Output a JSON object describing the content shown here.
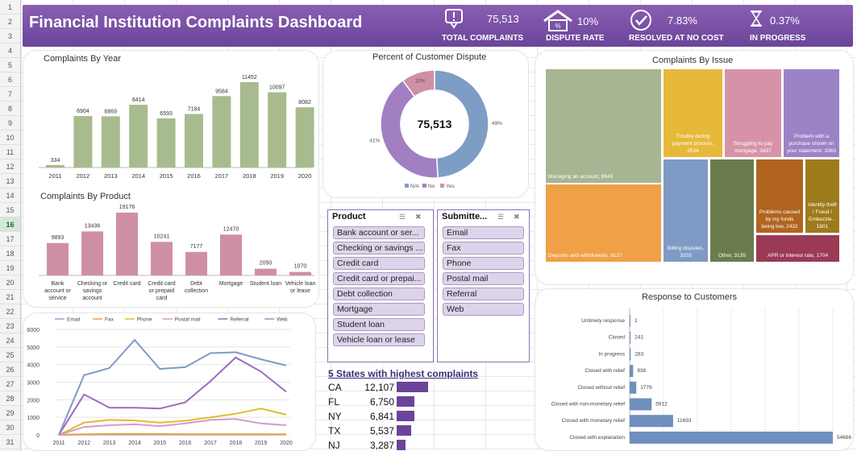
{
  "row_numbers": [
    "1",
    "2",
    "3",
    "4",
    "5",
    "6",
    "7",
    "8",
    "9",
    "10",
    "11",
    "12",
    "13",
    "14",
    "15",
    "16",
    "17",
    "18",
    "19",
    "20",
    "21",
    "22",
    "23",
    "24",
    "25",
    "26",
    "27",
    "28",
    "29",
    "30",
    "31"
  ],
  "selected_row": "16",
  "header": {
    "title": "Financial Institution Complaints Dashboard",
    "kpis": [
      {
        "value": "75,513",
        "label": "TOTAL COMPLAINTS",
        "icon": "complaint-icon"
      },
      {
        "value": "10%",
        "label": "DISPUTE RATE",
        "icon": "house-icon"
      },
      {
        "value": "7.83%",
        "label": "RESOLVED AT NO COST",
        "icon": "check-circle-icon"
      },
      {
        "value": "0.37%",
        "label": "IN PROGRESS",
        "icon": "hourglass-icon"
      }
    ]
  },
  "colors": {
    "banner": "#6b449a",
    "green": "#a8bb8e",
    "pink": "#cf8fa4",
    "blue": "#7e9dc4",
    "purple": "#a27fc3",
    "steel": "#6f8fbf"
  },
  "charts": {
    "by_year": {
      "title": "Complaints By Year",
      "chart_data": {
        "type": "bar",
        "categories": [
          "2011",
          "2012",
          "2013",
          "2014",
          "2015",
          "2016",
          "2017",
          "2018",
          "2019",
          "2020"
        ],
        "values": [
          334,
          6904,
          6869,
          8414,
          6593,
          7184,
          9584,
          11452,
          10097,
          8082
        ]
      }
    },
    "by_product": {
      "title": "Complaints By Product",
      "chart_data": {
        "type": "bar",
        "categories": [
          [
            "Bank",
            "account or",
            "service"
          ],
          [
            "Checking or",
            "savings",
            "account"
          ],
          [
            "Credit card"
          ],
          [
            "Credit card",
            "or prepaid",
            "card"
          ],
          [
            "Debt",
            "collection"
          ],
          [
            "Mortgage"
          ],
          [
            "Student loan"
          ],
          [
            "Vehicle loan",
            "or lease"
          ]
        ],
        "values": [
          9893,
          13436,
          19176,
          10241,
          7177,
          12470,
          2050,
          1070
        ]
      }
    },
    "dispute": {
      "title": "Percent of Customer Dispute",
      "center": "75,513",
      "chart_data": {
        "type": "pie",
        "categories": [
          "N/A",
          "No",
          "Yes"
        ],
        "values": [
          49,
          41,
          10
        ],
        "labels": [
          "49%",
          "41%",
          "10%"
        ],
        "legend": [
          "N/A",
          "No",
          "Yes"
        ]
      }
    },
    "by_issue": {
      "title": "Complaints By Issue",
      "chart_data": {
        "type": "treemap",
        "items": [
          {
            "label": "Managing an account, 8849",
            "value": 8849
          },
          {
            "label": "Deposits and withdrawals, 6127",
            "value": 6127
          },
          {
            "label": "Trouble during payment process, 3534",
            "value": 3534
          },
          {
            "label": "Struggling to pay mortgage, 3437",
            "value": 3437
          },
          {
            "label": "Problem with a purchase shown on your statement, 3365",
            "value": 3365
          },
          {
            "label": "Billing disputes, 3203",
            "value": 3203
          },
          {
            "label": "Other, 3135",
            "value": 3135
          },
          {
            "label": "Problems caused by my funds being low, 2432",
            "value": 2432
          },
          {
            "label": "Identity theft / Fraud / Embezzle... 1801",
            "value": 1801
          },
          {
            "label": "APR or interest rate, 1704",
            "value": 1704
          }
        ]
      }
    },
    "by_channel": {
      "chart_data": {
        "type": "line",
        "x": [
          "2011",
          "2012",
          "2013",
          "2014",
          "2015",
          "2016",
          "2017",
          "2018",
          "2019",
          "2020"
        ],
        "ylim": [
          0,
          6000
        ],
        "yticks": [
          "0",
          "1000",
          "2000",
          "3000",
          "4000",
          "5000",
          "6000"
        ],
        "series": [
          {
            "name": "Email",
            "values": [
              0,
              20,
              20,
              20,
              20,
              20,
              20,
              20,
              20,
              20
            ]
          },
          {
            "name": "Fax",
            "values": [
              0,
              30,
              60,
              60,
              50,
              40,
              40,
              40,
              40,
              30
            ]
          },
          {
            "name": "Phone",
            "values": [
              0,
              700,
              850,
              820,
              700,
              800,
              1000,
              1200,
              1500,
              1150
            ]
          },
          {
            "name": "Postal mail",
            "values": [
              0,
              450,
              550,
              600,
              500,
              650,
              850,
              900,
              650,
              550
            ]
          },
          {
            "name": "Referral",
            "values": [
              0,
              2300,
              1550,
              1550,
              1500,
              1850,
              3050,
              4400,
              3600,
              2450
            ]
          },
          {
            "name": "Web",
            "values": [
              0,
              3400,
              3800,
              5400,
              3750,
              3850,
              4650,
              4700,
              4300,
              3950
            ]
          }
        ]
      }
    },
    "response": {
      "title": "Response to Customers",
      "chart_data": {
        "type": "bar",
        "orientation": "horizontal",
        "categories": [
          "Untimely response",
          "Closed",
          "In progress",
          "Closed with relief",
          "Closed without relief",
          "Closed with non-monetary relief",
          "Closed with monetary relief",
          "Closed with explanation"
        ],
        "values": [
          1,
          241,
          283,
          938,
          1779,
          5912,
          11693,
          54666
        ]
      }
    }
  },
  "slicers": {
    "product": {
      "title": "Product",
      "items": [
        "Bank account or ser...",
        "Checking or savings ...",
        "Credit card",
        "Credit card or prepai...",
        "Debt collection",
        "Mortgage",
        "Student loan",
        "Vehicle loan or lease"
      ]
    },
    "submitted": {
      "title": "Submitte...",
      "items": [
        "Email",
        "Fax",
        "Phone",
        "Postal mail",
        "Referral",
        "Web"
      ]
    }
  },
  "states": {
    "title": "5 States with highest complaints",
    "rows": [
      {
        "state": "CA",
        "value": "12,107",
        "n": 12107
      },
      {
        "state": "FL",
        "value": "6,750",
        "n": 6750
      },
      {
        "state": "NY",
        "value": "6,841",
        "n": 6841
      },
      {
        "state": "TX",
        "value": "5,537",
        "n": 5537
      },
      {
        "state": "NJ",
        "value": "3,287",
        "n": 3287
      }
    ]
  }
}
